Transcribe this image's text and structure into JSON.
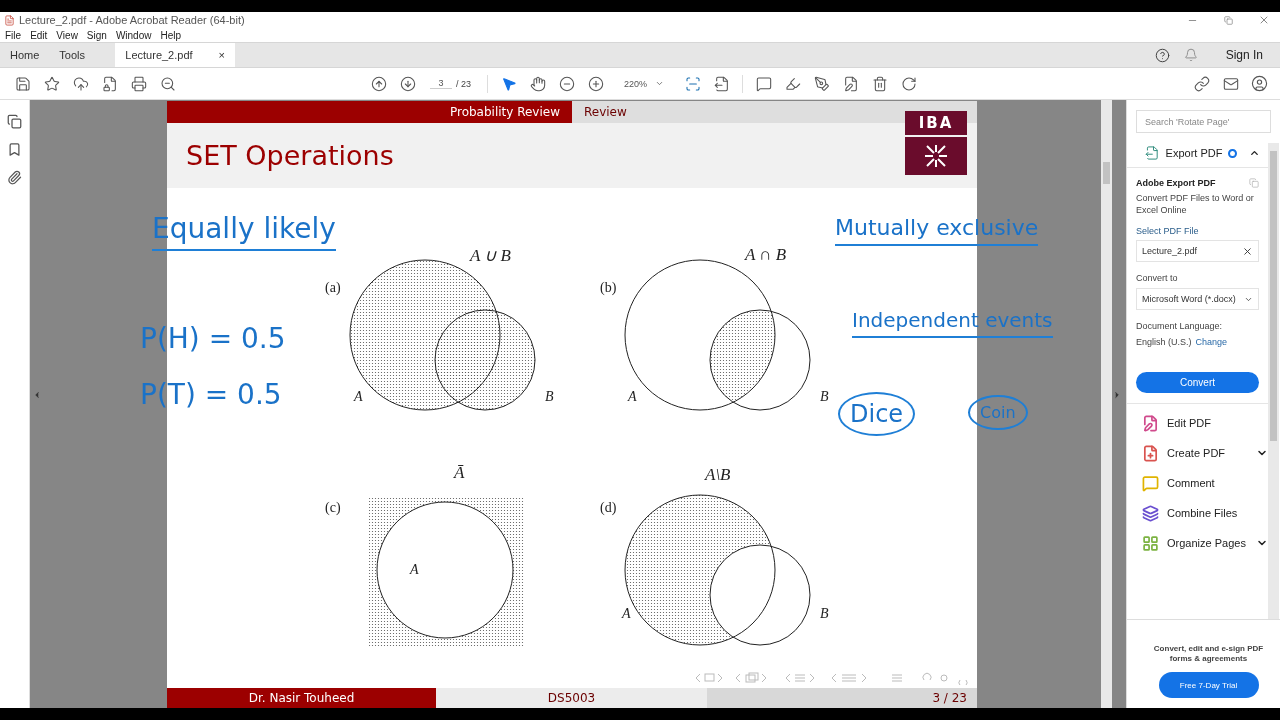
{
  "window": {
    "title": "Lecture_2.pdf - Adobe Acrobat Reader (64-bit)"
  },
  "menu": [
    "File",
    "Edit",
    "View",
    "Sign",
    "Window",
    "Help"
  ],
  "tabs": [
    {
      "label": "Home",
      "selected": false,
      "kind": "nav"
    },
    {
      "label": "Tools",
      "selected": false,
      "kind": "nav"
    },
    {
      "label": "Lecture_2.pdf",
      "selected": true,
      "kind": "document",
      "close": "×"
    }
  ],
  "account": {
    "sign_in": "Sign In"
  },
  "toolbar": {
    "page": "3",
    "page_total": "/ 23",
    "zoom": "220%"
  },
  "slide": {
    "section": "Probability Review",
    "subsection": "Review",
    "title": "SET Operations",
    "logo": "IBA",
    "diagrams": [
      {
        "label": "(a)",
        "title": "A ∪ B",
        "set_a": "A",
        "set_b": "B",
        "kind": "union"
      },
      {
        "label": "(b)",
        "title": "A ∩ B",
        "set_a": "A",
        "set_b": "B",
        "kind": "intersection"
      },
      {
        "label": "(c)",
        "title": "Ā",
        "set_a": "A",
        "kind": "complement"
      },
      {
        "label": "(d)",
        "title": "A\\B",
        "set_a": "A",
        "set_b": "B",
        "kind": "difference"
      }
    ],
    "annotations": [
      {
        "text": "Equally likely",
        "kind": "underlined"
      },
      {
        "text": "P(H) = 0.5",
        "kind": "plain"
      },
      {
        "text": "P(T) = 0.5",
        "kind": "plain"
      },
      {
        "text": "Mutually exclusive",
        "kind": "underlined"
      },
      {
        "text": "Independent events",
        "kind": "underlined"
      },
      {
        "text": "Dice",
        "kind": "circled"
      },
      {
        "text": "Coin",
        "kind": "circled"
      }
    ],
    "footer": {
      "author": "Dr. Nasir Touheed",
      "course": "DS5003",
      "page": "3 / 23"
    }
  },
  "panel": {
    "search": {
      "placeholder": "Search 'Rotate Page'"
    },
    "export": {
      "title": "Export PDF",
      "expanded": true,
      "heading": "Adobe Export PDF",
      "description": "Convert PDF Files to Word or Excel Online",
      "select_label": "Select PDF File",
      "file": "Lecture_2.pdf",
      "convert_label": "Convert to",
      "format": "Microsoft Word (*.docx)",
      "language_label": "Document Language:",
      "language": "English (U.S.)",
      "change": "Change",
      "button": "Convert"
    },
    "tools": [
      {
        "label": "Edit PDF",
        "has_menu": false,
        "color": "#d04a8c"
      },
      {
        "label": "Create PDF",
        "has_menu": true,
        "color": "#d9534f"
      },
      {
        "label": "Comment",
        "has_menu": false,
        "color": "#e0b400"
      },
      {
        "label": "Combine Files",
        "has_menu": false,
        "color": "#6a4fd0"
      },
      {
        "label": "Organize Pages",
        "has_menu": true,
        "color": "#7cb342"
      }
    ],
    "promo": {
      "text": "Convert, edit and e-sign PDF forms & agreements",
      "button": "Free 7-Day Trial"
    }
  }
}
